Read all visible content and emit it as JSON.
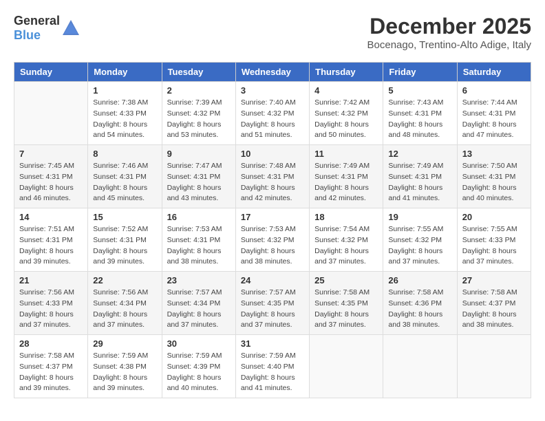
{
  "header": {
    "logo": {
      "general": "General",
      "blue": "Blue"
    },
    "title": "December 2025",
    "location": "Bocenago, Trentino-Alto Adige, Italy"
  },
  "calendar": {
    "days_of_week": [
      "Sunday",
      "Monday",
      "Tuesday",
      "Wednesday",
      "Thursday",
      "Friday",
      "Saturday"
    ],
    "weeks": [
      [
        {
          "day": "",
          "info": ""
        },
        {
          "day": "1",
          "info": "Sunrise: 7:38 AM\nSunset: 4:33 PM\nDaylight: 8 hours\nand 54 minutes."
        },
        {
          "day": "2",
          "info": "Sunrise: 7:39 AM\nSunset: 4:32 PM\nDaylight: 8 hours\nand 53 minutes."
        },
        {
          "day": "3",
          "info": "Sunrise: 7:40 AM\nSunset: 4:32 PM\nDaylight: 8 hours\nand 51 minutes."
        },
        {
          "day": "4",
          "info": "Sunrise: 7:42 AM\nSunset: 4:32 PM\nDaylight: 8 hours\nand 50 minutes."
        },
        {
          "day": "5",
          "info": "Sunrise: 7:43 AM\nSunset: 4:31 PM\nDaylight: 8 hours\nand 48 minutes."
        },
        {
          "day": "6",
          "info": "Sunrise: 7:44 AM\nSunset: 4:31 PM\nDaylight: 8 hours\nand 47 minutes."
        }
      ],
      [
        {
          "day": "7",
          "info": "Sunrise: 7:45 AM\nSunset: 4:31 PM\nDaylight: 8 hours\nand 46 minutes."
        },
        {
          "day": "8",
          "info": "Sunrise: 7:46 AM\nSunset: 4:31 PM\nDaylight: 8 hours\nand 45 minutes."
        },
        {
          "day": "9",
          "info": "Sunrise: 7:47 AM\nSunset: 4:31 PM\nDaylight: 8 hours\nand 43 minutes."
        },
        {
          "day": "10",
          "info": "Sunrise: 7:48 AM\nSunset: 4:31 PM\nDaylight: 8 hours\nand 42 minutes."
        },
        {
          "day": "11",
          "info": "Sunrise: 7:49 AM\nSunset: 4:31 PM\nDaylight: 8 hours\nand 42 minutes."
        },
        {
          "day": "12",
          "info": "Sunrise: 7:49 AM\nSunset: 4:31 PM\nDaylight: 8 hours\nand 41 minutes."
        },
        {
          "day": "13",
          "info": "Sunrise: 7:50 AM\nSunset: 4:31 PM\nDaylight: 8 hours\nand 40 minutes."
        }
      ],
      [
        {
          "day": "14",
          "info": "Sunrise: 7:51 AM\nSunset: 4:31 PM\nDaylight: 8 hours\nand 39 minutes."
        },
        {
          "day": "15",
          "info": "Sunrise: 7:52 AM\nSunset: 4:31 PM\nDaylight: 8 hours\nand 39 minutes."
        },
        {
          "day": "16",
          "info": "Sunrise: 7:53 AM\nSunset: 4:31 PM\nDaylight: 8 hours\nand 38 minutes."
        },
        {
          "day": "17",
          "info": "Sunrise: 7:53 AM\nSunset: 4:32 PM\nDaylight: 8 hours\nand 38 minutes."
        },
        {
          "day": "18",
          "info": "Sunrise: 7:54 AM\nSunset: 4:32 PM\nDaylight: 8 hours\nand 37 minutes."
        },
        {
          "day": "19",
          "info": "Sunrise: 7:55 AM\nSunset: 4:32 PM\nDaylight: 8 hours\nand 37 minutes."
        },
        {
          "day": "20",
          "info": "Sunrise: 7:55 AM\nSunset: 4:33 PM\nDaylight: 8 hours\nand 37 minutes."
        }
      ],
      [
        {
          "day": "21",
          "info": "Sunrise: 7:56 AM\nSunset: 4:33 PM\nDaylight: 8 hours\nand 37 minutes."
        },
        {
          "day": "22",
          "info": "Sunrise: 7:56 AM\nSunset: 4:34 PM\nDaylight: 8 hours\nand 37 minutes."
        },
        {
          "day": "23",
          "info": "Sunrise: 7:57 AM\nSunset: 4:34 PM\nDaylight: 8 hours\nand 37 minutes."
        },
        {
          "day": "24",
          "info": "Sunrise: 7:57 AM\nSunset: 4:35 PM\nDaylight: 8 hours\nand 37 minutes."
        },
        {
          "day": "25",
          "info": "Sunrise: 7:58 AM\nSunset: 4:35 PM\nDaylight: 8 hours\nand 37 minutes."
        },
        {
          "day": "26",
          "info": "Sunrise: 7:58 AM\nSunset: 4:36 PM\nDaylight: 8 hours\nand 38 minutes."
        },
        {
          "day": "27",
          "info": "Sunrise: 7:58 AM\nSunset: 4:37 PM\nDaylight: 8 hours\nand 38 minutes."
        }
      ],
      [
        {
          "day": "28",
          "info": "Sunrise: 7:58 AM\nSunset: 4:37 PM\nDaylight: 8 hours\nand 39 minutes."
        },
        {
          "day": "29",
          "info": "Sunrise: 7:59 AM\nSunset: 4:38 PM\nDaylight: 8 hours\nand 39 minutes."
        },
        {
          "day": "30",
          "info": "Sunrise: 7:59 AM\nSunset: 4:39 PM\nDaylight: 8 hours\nand 40 minutes."
        },
        {
          "day": "31",
          "info": "Sunrise: 7:59 AM\nSunset: 4:40 PM\nDaylight: 8 hours\nand 41 minutes."
        },
        {
          "day": "",
          "info": ""
        },
        {
          "day": "",
          "info": ""
        },
        {
          "day": "",
          "info": ""
        }
      ]
    ]
  }
}
